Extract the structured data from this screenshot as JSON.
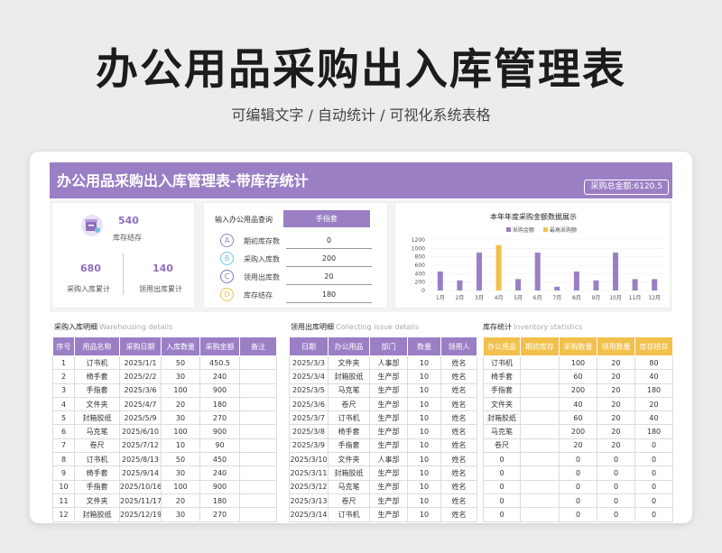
{
  "header": {
    "title": "办公用品采购出入库管理表",
    "subtitle": "可编辑文字  /  自动统计  /  可视化系统表格"
  },
  "sheet": {
    "banner_title": "办公用品采购出入库管理表-带库存统计",
    "total_label": "采购总金额:6120.5"
  },
  "stats": {
    "stock_value": "540",
    "stock_label": "库存结存",
    "in_value": "680",
    "in_label": "采购入库累计",
    "out_value": "140",
    "out_label": "领用出库累计",
    "icon": "box-icon"
  },
  "query": {
    "title": "输入办公用品查询",
    "selected": "手指套",
    "rows": [
      {
        "badge": "A",
        "name": "期初库存数",
        "value": "0",
        "color": "#9a7fc5"
      },
      {
        "badge": "B",
        "name": "采购入库数",
        "value": "200",
        "color": "#6fc3e0"
      },
      {
        "badge": "C",
        "name": "领用出库数",
        "value": "20",
        "color": "#8e6fc0"
      },
      {
        "badge": "D",
        "name": "库存结存",
        "value": "180",
        "color": "#f2c04c"
      }
    ]
  },
  "chart_data": {
    "type": "bar",
    "title": "本年年度采购金额数据展示",
    "categories": [
      "1月",
      "2月",
      "3月",
      "4月",
      "5月",
      "6月",
      "7月",
      "8月",
      "9月",
      "10月",
      "11月",
      "12月"
    ],
    "series": [
      {
        "name": "采购金额",
        "values": [
          450.5,
          240,
          900,
          0,
          270,
          900,
          90,
          450,
          240,
          900,
          270,
          270
        ],
        "color": "#9a7fc5"
      },
      {
        "name": "最高采购额",
        "values": [
          0,
          0,
          0,
          1080,
          0,
          0,
          0,
          0,
          0,
          0,
          0,
          0
        ],
        "color": "#f2c04c"
      }
    ],
    "y_ticks": [
      "0",
      "200",
      "400",
      "600",
      "800",
      "1000",
      "1200"
    ],
    "ylim": [
      0,
      1200
    ],
    "legend": "top"
  },
  "purchase": {
    "title": "采购入库明细",
    "title_en": "Warehousing details",
    "headers": [
      "序号",
      "用品名称",
      "采购日期",
      "入库数量",
      "采购金额",
      "备注"
    ],
    "rows": [
      [
        "1",
        "订书机",
        "2025/1/1",
        "50",
        "450.5",
        ""
      ],
      [
        "2",
        "椅手套",
        "2025/2/2",
        "30",
        "240",
        ""
      ],
      [
        "3",
        "手指套",
        "2025/3/6",
        "100",
        "900",
        ""
      ],
      [
        "4",
        "文件夹",
        "2025/4/7",
        "20",
        "180",
        ""
      ],
      [
        "5",
        "封箱胶纸",
        "2025/5/9",
        "30",
        "270",
        ""
      ],
      [
        "6",
        "马克笔",
        "2025/6/10",
        "100",
        "900",
        ""
      ],
      [
        "7",
        "卷尺",
        "2025/7/12",
        "10",
        "90",
        ""
      ],
      [
        "8",
        "订书机",
        "2025/8/13",
        "50",
        "450",
        ""
      ],
      [
        "9",
        "椅手套",
        "2025/9/14",
        "30",
        "240",
        ""
      ],
      [
        "10",
        "手指套",
        "2025/10/16",
        "100",
        "900",
        ""
      ],
      [
        "11",
        "文件夹",
        "2025/11/17",
        "20",
        "180",
        ""
      ],
      [
        "12",
        "封箱胶纸",
        "2025/12/19",
        "30",
        "270",
        ""
      ]
    ]
  },
  "issue": {
    "title": "领用出库明细",
    "title_en": "Collecting issue details",
    "headers": [
      "日期",
      "办公用品",
      "部门",
      "数量",
      "领用人"
    ],
    "rows": [
      [
        "2025/3/3",
        "文件夹",
        "人事部",
        "10",
        "姓名"
      ],
      [
        "2025/3/4",
        "封箱胶纸",
        "生产部",
        "10",
        "姓名"
      ],
      [
        "2025/3/5",
        "马克笔",
        "生产部",
        "10",
        "姓名"
      ],
      [
        "2025/3/6",
        "卷尺",
        "生产部",
        "10",
        "姓名"
      ],
      [
        "2025/3/7",
        "订书机",
        "生产部",
        "10",
        "姓名"
      ],
      [
        "2025/3/8",
        "椅手套",
        "生产部",
        "10",
        "姓名"
      ],
      [
        "2025/3/9",
        "手指套",
        "生产部",
        "10",
        "姓名"
      ],
      [
        "2025/3/10",
        "文件夹",
        "人事部",
        "10",
        "姓名"
      ],
      [
        "2025/3/11",
        "封箱胶纸",
        "生产部",
        "10",
        "姓名"
      ],
      [
        "2025/3/12",
        "马克笔",
        "生产部",
        "10",
        "姓名"
      ],
      [
        "2025/3/13",
        "卷尺",
        "生产部",
        "10",
        "姓名"
      ],
      [
        "2025/3/14",
        "订书机",
        "生产部",
        "10",
        "姓名"
      ]
    ]
  },
  "inventory": {
    "title": "库存统计",
    "title_en": "Inventory statistics",
    "headers": [
      "办公用品",
      "期初库存",
      "采购数量",
      "领用数量",
      "库存结存"
    ],
    "rows": [
      [
        "订书机",
        "",
        "100",
        "20",
        "80"
      ],
      [
        "椅手套",
        "",
        "60",
        "20",
        "40"
      ],
      [
        "手指套",
        "",
        "200",
        "20",
        "180"
      ],
      [
        "文件夹",
        "",
        "40",
        "20",
        "20"
      ],
      [
        "封箱胶纸",
        "",
        "60",
        "20",
        "40"
      ],
      [
        "马克笔",
        "",
        "200",
        "20",
        "180"
      ],
      [
        "卷尺",
        "",
        "20",
        "20",
        "0"
      ],
      [
        "0",
        "",
        "0",
        "0",
        "0"
      ],
      [
        "0",
        "",
        "0",
        "0",
        "0"
      ],
      [
        "0",
        "",
        "0",
        "0",
        "0"
      ],
      [
        "0",
        "",
        "0",
        "0",
        "0"
      ],
      [
        "0",
        "",
        "0",
        "0",
        "0"
      ]
    ]
  }
}
